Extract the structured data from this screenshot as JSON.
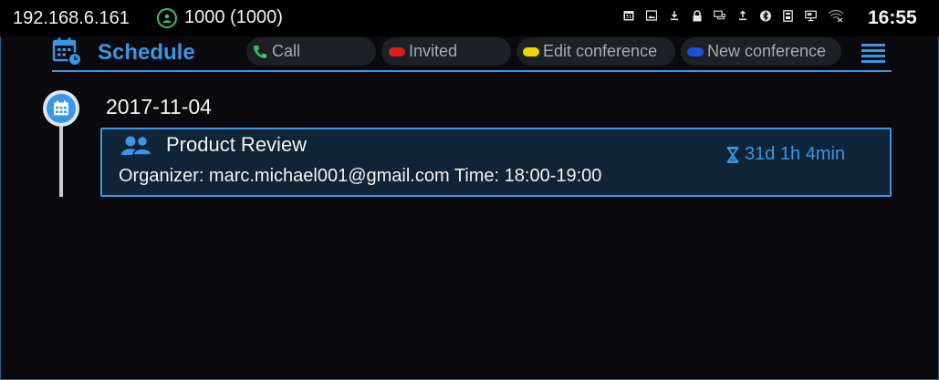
{
  "status_bar": {
    "ip": "192.168.6.161",
    "account": "1000 (1000)",
    "time": "16:55",
    "icons": [
      "calendar-icon",
      "image-icon",
      "download-icon",
      "lock-icon",
      "network-icon",
      "upload-icon",
      "bluetooth-icon",
      "sim-icon",
      "monitor-icon",
      "wifi-icon"
    ]
  },
  "header": {
    "title": "Schedule",
    "legend": [
      {
        "label": "Call",
        "color": "#3ec15a"
      },
      {
        "label": "Invited",
        "color": "#e01b1b"
      },
      {
        "label": "Edit conference",
        "color": "#f2d400"
      },
      {
        "label": "New conference",
        "color": "#1f4fd6"
      }
    ]
  },
  "schedule": {
    "date": "2017-11-04",
    "event": {
      "title": "Product Review",
      "details": "Organizer: marc.michael001@gmail.com Time: 18:00-19:00",
      "countdown": "31d 1h 4min"
    }
  },
  "colors": {
    "accent": "#3a96e6",
    "background": "#0a0a0c",
    "card_bg": "#0f2436"
  }
}
